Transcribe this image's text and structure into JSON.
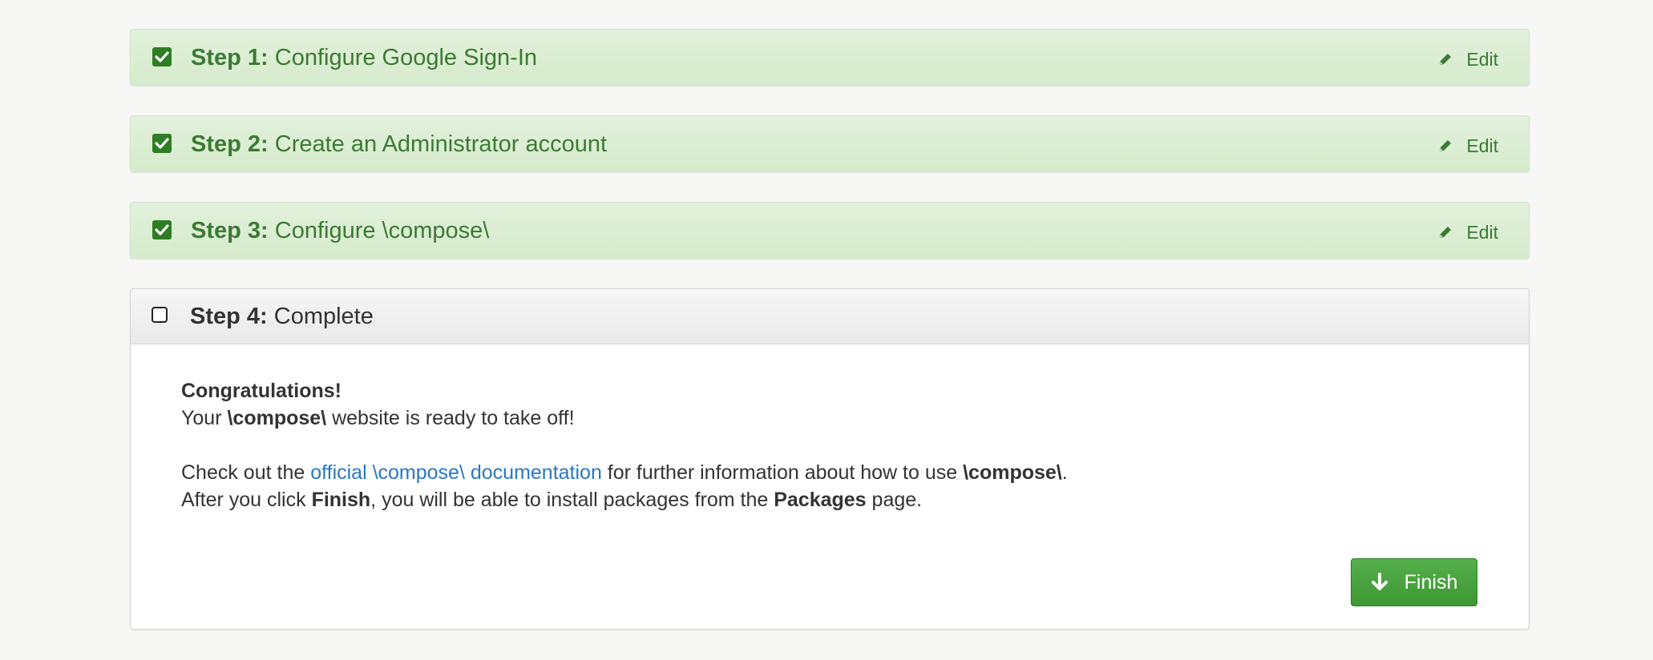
{
  "steps": [
    {
      "prefix": "Step 1:",
      "title": "Configure Google Sign-In",
      "edit_label": "Edit",
      "checked": true
    },
    {
      "prefix": "Step 2:",
      "title": "Create an Administrator account",
      "edit_label": "Edit",
      "checked": true
    },
    {
      "prefix": "Step 3:",
      "title": "Configure \\compose\\",
      "edit_label": "Edit",
      "checked": true
    }
  ],
  "step4": {
    "prefix": "Step 4:",
    "title": "Complete",
    "checked": false,
    "congrats": "Congratulations!",
    "ready_1": "Your ",
    "ready_bold": "\\compose\\",
    "ready_2": " website is ready to take off!",
    "docs_1": "Check out the ",
    "docs_link": "official \\compose\\ documentation",
    "docs_2": " for further information about how to use ",
    "docs_bold": "\\compose\\",
    "docs_3": ".",
    "after_1": "After you click ",
    "after_bold1": "Finish",
    "after_2": ", you will be able to install packages from the ",
    "after_bold2": "Packages",
    "after_3": " page.",
    "finish_label": "Finish"
  },
  "icons": {
    "checked": "checkbox-checked-icon",
    "unchecked": "checkbox-unchecked-icon",
    "edit": "pencil-icon",
    "finish": "arrow-down-icon"
  },
  "colors": {
    "success_text": "#3b7a33",
    "success_bg": "#dff0d8",
    "link": "#2a78c0",
    "button": "#449d44"
  }
}
